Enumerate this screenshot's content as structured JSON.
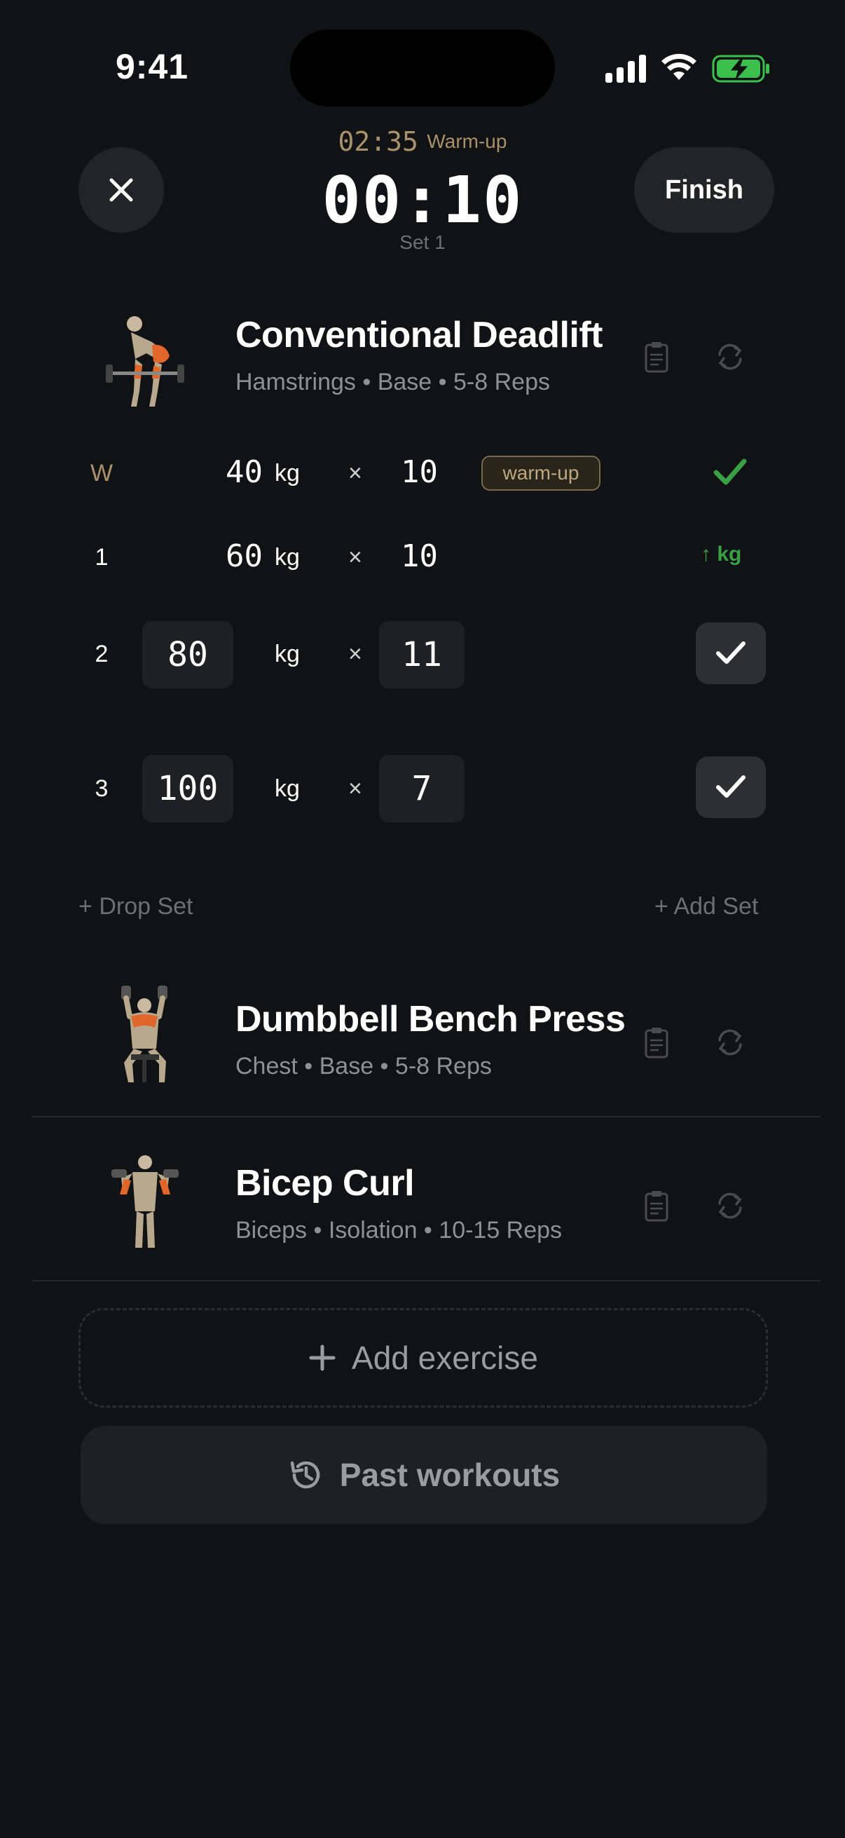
{
  "status_bar": {
    "time": "9:41"
  },
  "header": {
    "rest_time": "02:35",
    "rest_label": "Warm-up",
    "timer": "00:10",
    "set_label": "Set 1",
    "finish_label": "Finish"
  },
  "exercises": [
    {
      "title": "Conventional Deadlift",
      "subtitle": "Hamstrings • Base • 5-8 Reps",
      "sets": [
        {
          "label": "W",
          "weight": "40",
          "unit": "kg",
          "times": "×",
          "reps": "10",
          "tag": "warm-up",
          "status": "done"
        },
        {
          "label": "1",
          "weight": "60",
          "unit": "kg",
          "times": "×",
          "reps": "10",
          "hint": "↑ kg"
        },
        {
          "label": "2",
          "weight": "80",
          "unit": "kg",
          "times": "×",
          "reps": "11"
        },
        {
          "label": "3",
          "weight": "100",
          "unit": "kg",
          "times": "×",
          "reps": "7"
        }
      ],
      "drop_set_label": "Drop Set",
      "add_set_label": "Add Set"
    },
    {
      "title": "Dumbbell Bench Press",
      "subtitle": "Chest • Base • 5-8 Reps"
    },
    {
      "title": "Bicep Curl",
      "subtitle": "Biceps • Isolation • 10-15 Reps"
    }
  ],
  "add_exercise_label": "Add exercise",
  "past_workouts_label": "Past workouts",
  "colors": {
    "accent_gold": "#a8916b",
    "check_green": "#3aa046",
    "background": "#111214"
  }
}
